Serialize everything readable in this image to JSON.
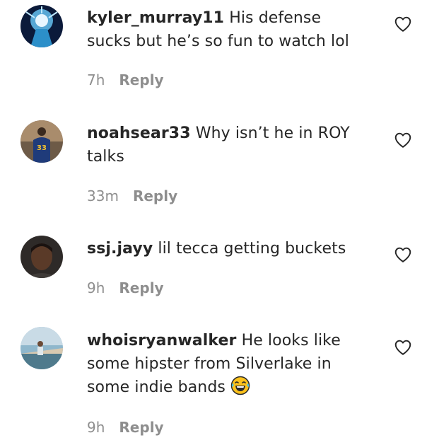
{
  "comments": [
    {
      "username": "kyler_murray11",
      "text": "His defense sucks but he’s so fun to watch lol",
      "time": "7h",
      "reply_label": "Reply"
    },
    {
      "username": "noahsear33",
      "text": "Why isn’t he in ROY talks",
      "time": "33m",
      "reply_label": "Reply"
    },
    {
      "username": "ssj.jayy",
      "text": "lil tecca getting buckets",
      "time": "9h",
      "reply_label": "Reply"
    },
    {
      "username": "whoisryanwalker",
      "text": "He looks like some hipster from Silverlake in some indie bands",
      "emoji": "laughing-crying-emoji",
      "time": "9h",
      "reply_label": "Reply"
    }
  ],
  "icons": {
    "like": "heart-outline-icon"
  },
  "colors": {
    "text": "#262626",
    "secondary": "#8e8e8e"
  }
}
